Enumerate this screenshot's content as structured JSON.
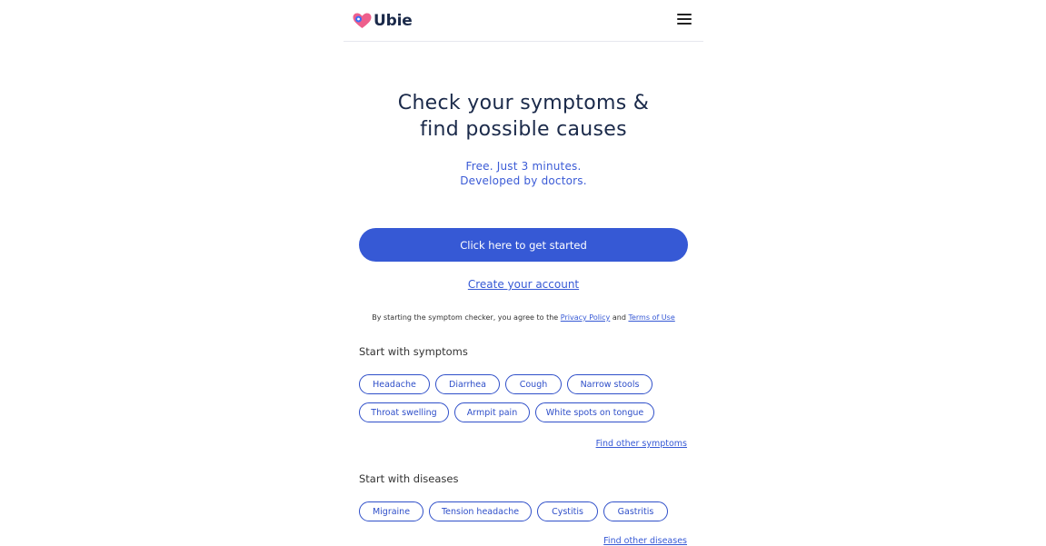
{
  "header": {
    "brand": "Ubie",
    "menu_icon": "hamburger-menu-icon",
    "logo_icon": "heart-logo-icon"
  },
  "hero": {
    "title_line1": "Check your symptoms &",
    "title_line2": "find possible causes",
    "tagline_line1": "Free. Just 3 minutes.",
    "tagline_line2": "Developed by doctors."
  },
  "cta": {
    "label": "Click here to get started",
    "create_account": "Create your account"
  },
  "consent": {
    "prefix": "By starting the symptom checker, you agree to the",
    "privacy": "Privacy Policy",
    "and": "and",
    "terms": "Terms of Use"
  },
  "symptoms": {
    "title": "Start with symptoms",
    "chips": [
      "Headache",
      "Diarrhea",
      "Cough",
      "Narrow stools",
      "Throat swelling",
      "Armpit pain",
      "White spots on tongue"
    ],
    "find_other": "Find other symptoms"
  },
  "diseases": {
    "title": "Start with diseases",
    "chips": [
      "Migraine",
      "Tension headache",
      "Cystitis",
      "Gastritis"
    ],
    "find_other": "Find other diseases"
  },
  "colors": {
    "primary": "#3659d5",
    "heading": "#1b2a4a",
    "logo_pink": "#ee5f8c",
    "logo_blue": "#3e6ef3"
  }
}
